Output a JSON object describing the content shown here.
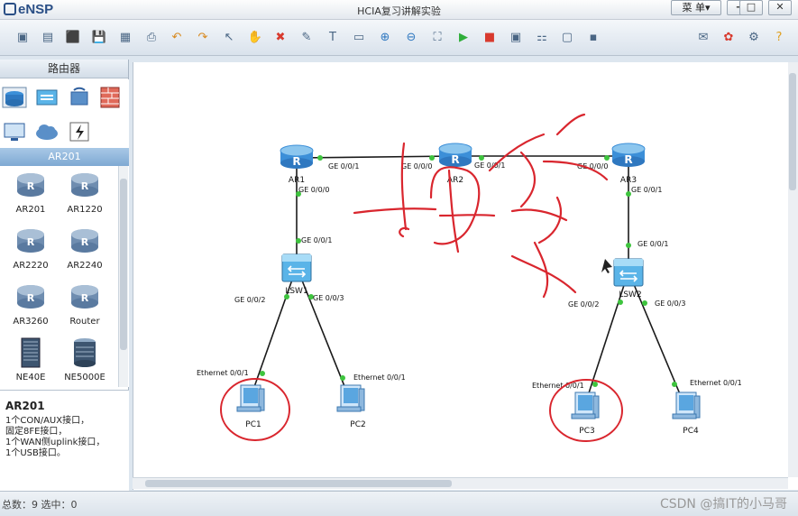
{
  "app": {
    "logo": "eNSP",
    "title": "HCIA复习讲解实验",
    "menu_label": "菜 单▾"
  },
  "window_controls": [
    "–",
    "□",
    "✕"
  ],
  "toolbar": {
    "icons": [
      "new-topology-icon",
      "new-example-icon",
      "open-icon",
      "save-icon",
      "save-as-icon",
      "print-icon",
      "undo-icon",
      "redo-icon",
      "pointer-icon",
      "hand-icon",
      "delete-icon",
      "delete-link-icon",
      "text-icon",
      "palette-icon",
      "zoom-in-icon",
      "zoom-out-icon",
      "fit-icon",
      "start-icon",
      "stop-icon",
      "capture-icon",
      "grid-icon",
      "topology-icon",
      "console-icon"
    ],
    "right_icons": [
      "chat-icon",
      "huawei-icon",
      "settings-icon",
      "help-icon"
    ]
  },
  "left_panel": {
    "category_title": "路由器",
    "category_icons": [
      "router-category-icon",
      "switch-category-icon",
      "wireless-category-icon",
      "firewall-category-icon",
      "pc-category-icon",
      "cloud-category-icon",
      "other-category-icon"
    ],
    "selected_type": "AR201",
    "devices": [
      {
        "label": "AR201",
        "icon": "router-icon"
      },
      {
        "label": "AR1220",
        "icon": "router-icon"
      },
      {
        "label": "AR2220",
        "icon": "router-icon"
      },
      {
        "label": "AR2240",
        "icon": "router-icon"
      },
      {
        "label": "AR3260",
        "icon": "router-icon"
      },
      {
        "label": "Router",
        "icon": "router-icon"
      },
      {
        "label": "NE40E",
        "icon": "ne-chassis-icon"
      },
      {
        "label": "NE5000E",
        "icon": "ne-chassis-icon"
      }
    ],
    "description": {
      "title": "AR201",
      "text": "1个CON/AUX接口，\n固定8FE接口，\n1个WAN侧uplink接口，\n1个USB接口。"
    }
  },
  "topology": {
    "nodes": [
      {
        "id": "AR1",
        "label": "AR1",
        "type": "router"
      },
      {
        "id": "AR2",
        "label": "AR2",
        "type": "router"
      },
      {
        "id": "AR3",
        "label": "AR3",
        "type": "router"
      },
      {
        "id": "LSW1",
        "label": "LSW1",
        "type": "switch"
      },
      {
        "id": "LSW2",
        "label": "LSW2",
        "type": "switch"
      },
      {
        "id": "PC1",
        "label": "PC1",
        "type": "pc"
      },
      {
        "id": "PC2",
        "label": "PC2",
        "type": "pc"
      },
      {
        "id": "PC3",
        "label": "PC3",
        "type": "pc"
      },
      {
        "id": "PC4",
        "label": "PC4",
        "type": "pc"
      }
    ],
    "links": [
      {
        "from": "AR1",
        "to": "AR2",
        "from_port": "GE 0/0/1",
        "to_port": "GE 0/0/0"
      },
      {
        "from": "AR2",
        "to": "AR3",
        "from_port": "GE 0/0/1",
        "to_port": "GE 0/0/0"
      },
      {
        "from": "AR1",
        "to": "LSW1",
        "from_port": "GE 0/0/0",
        "to_port": "GE 0/0/1"
      },
      {
        "from": "AR3",
        "to": "LSW2",
        "from_port": "GE 0/0/1",
        "to_port": "GE 0/0/1"
      },
      {
        "from": "LSW1",
        "to": "PC1",
        "from_port": "GE 0/0/2",
        "to_port": "Ethernet 0/0/1"
      },
      {
        "from": "LSW1",
        "to": "PC2",
        "from_port": "GE 0/0/3",
        "to_port": "Ethernet 0/0/1"
      },
      {
        "from": "LSW2",
        "to": "PC3",
        "from_port": "GE 0/0/2",
        "to_port": "Ethernet 0/0/1"
      },
      {
        "from": "LSW2",
        "to": "PC4",
        "from_port": "GE 0/0/3",
        "to_port": "Ethernet 0/0/1"
      }
    ],
    "annotation_color": "#d9262e",
    "handwritten_note": "抽象"
  },
  "status_bar": {
    "text": "总数：9  选中：0",
    "watermark": "CSDN @搞IT的小马哥"
  },
  "colors": {
    "link": "#1a1a1a",
    "port_dot": "#3ec43e",
    "router": "#3c8fd8",
    "switch": "#5ab4e8"
  }
}
